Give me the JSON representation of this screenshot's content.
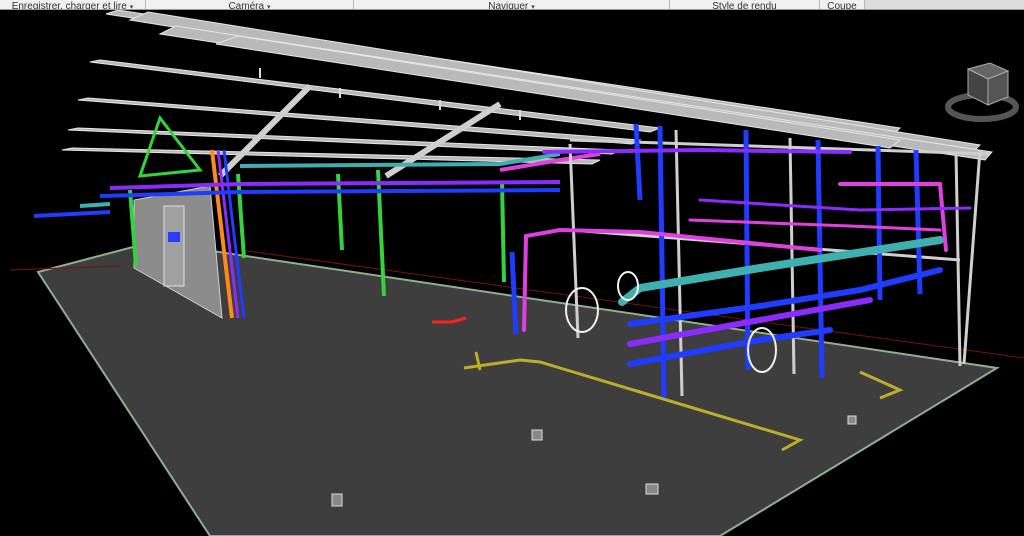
{
  "ribbon": {
    "groups": [
      {
        "label": "Enregistrer, charger et lire",
        "caret": "▾"
      },
      {
        "label": "Caméra",
        "caret": "▾"
      },
      {
        "label": "Naviguer",
        "caret": "▾"
      },
      {
        "label": "Style de rendu",
        "caret": ""
      },
      {
        "label": "Coupe",
        "caret": ""
      },
      {
        "label": "",
        "caret": ""
      }
    ]
  },
  "viewport": {
    "background": "#000000",
    "floor_color": "#3e3e3e",
    "steel_color": "#c8c8c8",
    "pipe_colors": {
      "blue": "#1f3cff",
      "violet": "#8b2cff",
      "magenta": "#e040e0",
      "teal": "#3fb0b0",
      "green": "#34d23c",
      "orange": "#ff8a1a",
      "yellow": "#bcae2a"
    },
    "navigation": {
      "view_cube_icon": "view-cube-icon"
    }
  }
}
